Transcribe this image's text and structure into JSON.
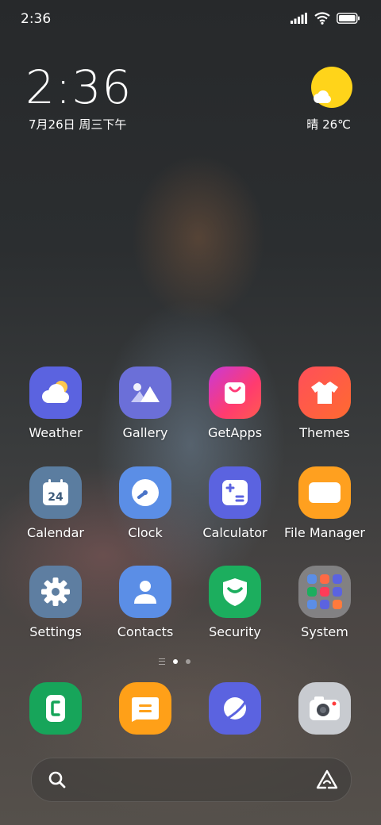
{
  "status_bar": {
    "time": "2:36",
    "icons": [
      "signal-icon",
      "wifi-icon",
      "battery-icon"
    ]
  },
  "clock_widget": {
    "time": "2:36",
    "date": "7月26日 周三下午"
  },
  "weather_widget": {
    "icon": "sun-cloud-icon",
    "text": "晴 26℃"
  },
  "apps": [
    {
      "label": "Weather",
      "icon": "weather-icon",
      "color": "#5b63e0"
    },
    {
      "label": "Gallery",
      "icon": "gallery-icon",
      "color": "#6b6fd8"
    },
    {
      "label": "GetApps",
      "icon": "shopping-bag-icon",
      "color": "#ff3c78"
    },
    {
      "label": "Themes",
      "icon": "tshirt-icon",
      "color": "#ff5a44"
    },
    {
      "label": "Calendar",
      "icon": "calendar-icon",
      "color": "#5b7da0",
      "badge": "24"
    },
    {
      "label": "Clock",
      "icon": "clock-icon",
      "color": "#5b8ee6"
    },
    {
      "label": "Calculator",
      "icon": "calculator-icon",
      "color": "#5b63e0"
    },
    {
      "label": "File Manager",
      "icon": "folder-icon",
      "color": "#ffa01f"
    },
    {
      "label": "Settings",
      "icon": "gear-icon",
      "color": "#5e7ea1"
    },
    {
      "label": "Contacts",
      "icon": "contact-icon",
      "color": "#5b8ee6"
    },
    {
      "label": "Security",
      "icon": "shield-icon",
      "color": "#1cae5e"
    },
    {
      "label": "System",
      "icon": "folder-grid-icon",
      "color": "#8f8f91"
    }
  ],
  "page_indicator": {
    "pages": 2,
    "active": 1
  },
  "dock": [
    {
      "name": "phone",
      "icon": "phone-icon",
      "color": "#17a55a"
    },
    {
      "name": "messages",
      "icon": "message-icon",
      "color": "#ffa018"
    },
    {
      "name": "browser",
      "icon": "planet-icon",
      "color": "#5b63e0"
    },
    {
      "name": "camera",
      "icon": "camera-icon",
      "color": "#c8cbd0"
    }
  ],
  "search_bar": {
    "left_icon": "search-icon",
    "right_icon": "assistant-icon"
  }
}
